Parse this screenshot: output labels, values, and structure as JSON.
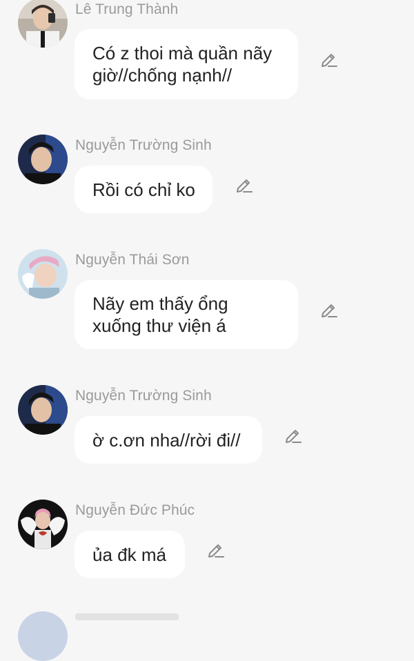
{
  "messages": [
    {
      "sender": "Lê Trung Thành",
      "lines": [
        "Có z thoi mà quần nãy",
        "giờ//chống nạnh//"
      ],
      "avatar": "avatar-photo-young-man-tie"
    },
    {
      "sender": "Nguyễn Trường Sinh",
      "lines": [
        "Rồi có chỉ ko"
      ],
      "avatar": "avatar-photo-dark-hair"
    },
    {
      "sender": "Nguyễn Thái Sơn",
      "lines": [
        "Nãy em thấy ổng",
        "xuống thư viện á"
      ],
      "avatar": "avatar-photo-pink-hair"
    },
    {
      "sender": "Nguyễn Trường Sinh",
      "lines": [
        "ờ c.ơn nha//rời đi//"
      ],
      "avatar": "avatar-photo-dark-hair"
    },
    {
      "sender": "Nguyễn Đức Phúc",
      "lines": [
        "ủa đk má"
      ],
      "avatar": "avatar-photo-wings"
    }
  ],
  "icons": {
    "edit": "pencil-edit-icon"
  },
  "colors": {
    "background": "#f6f6f6",
    "bubble": "#ffffff",
    "sender_text": "#9a9a9a",
    "message_text": "#222222",
    "icon": "#8a8a8a"
  }
}
